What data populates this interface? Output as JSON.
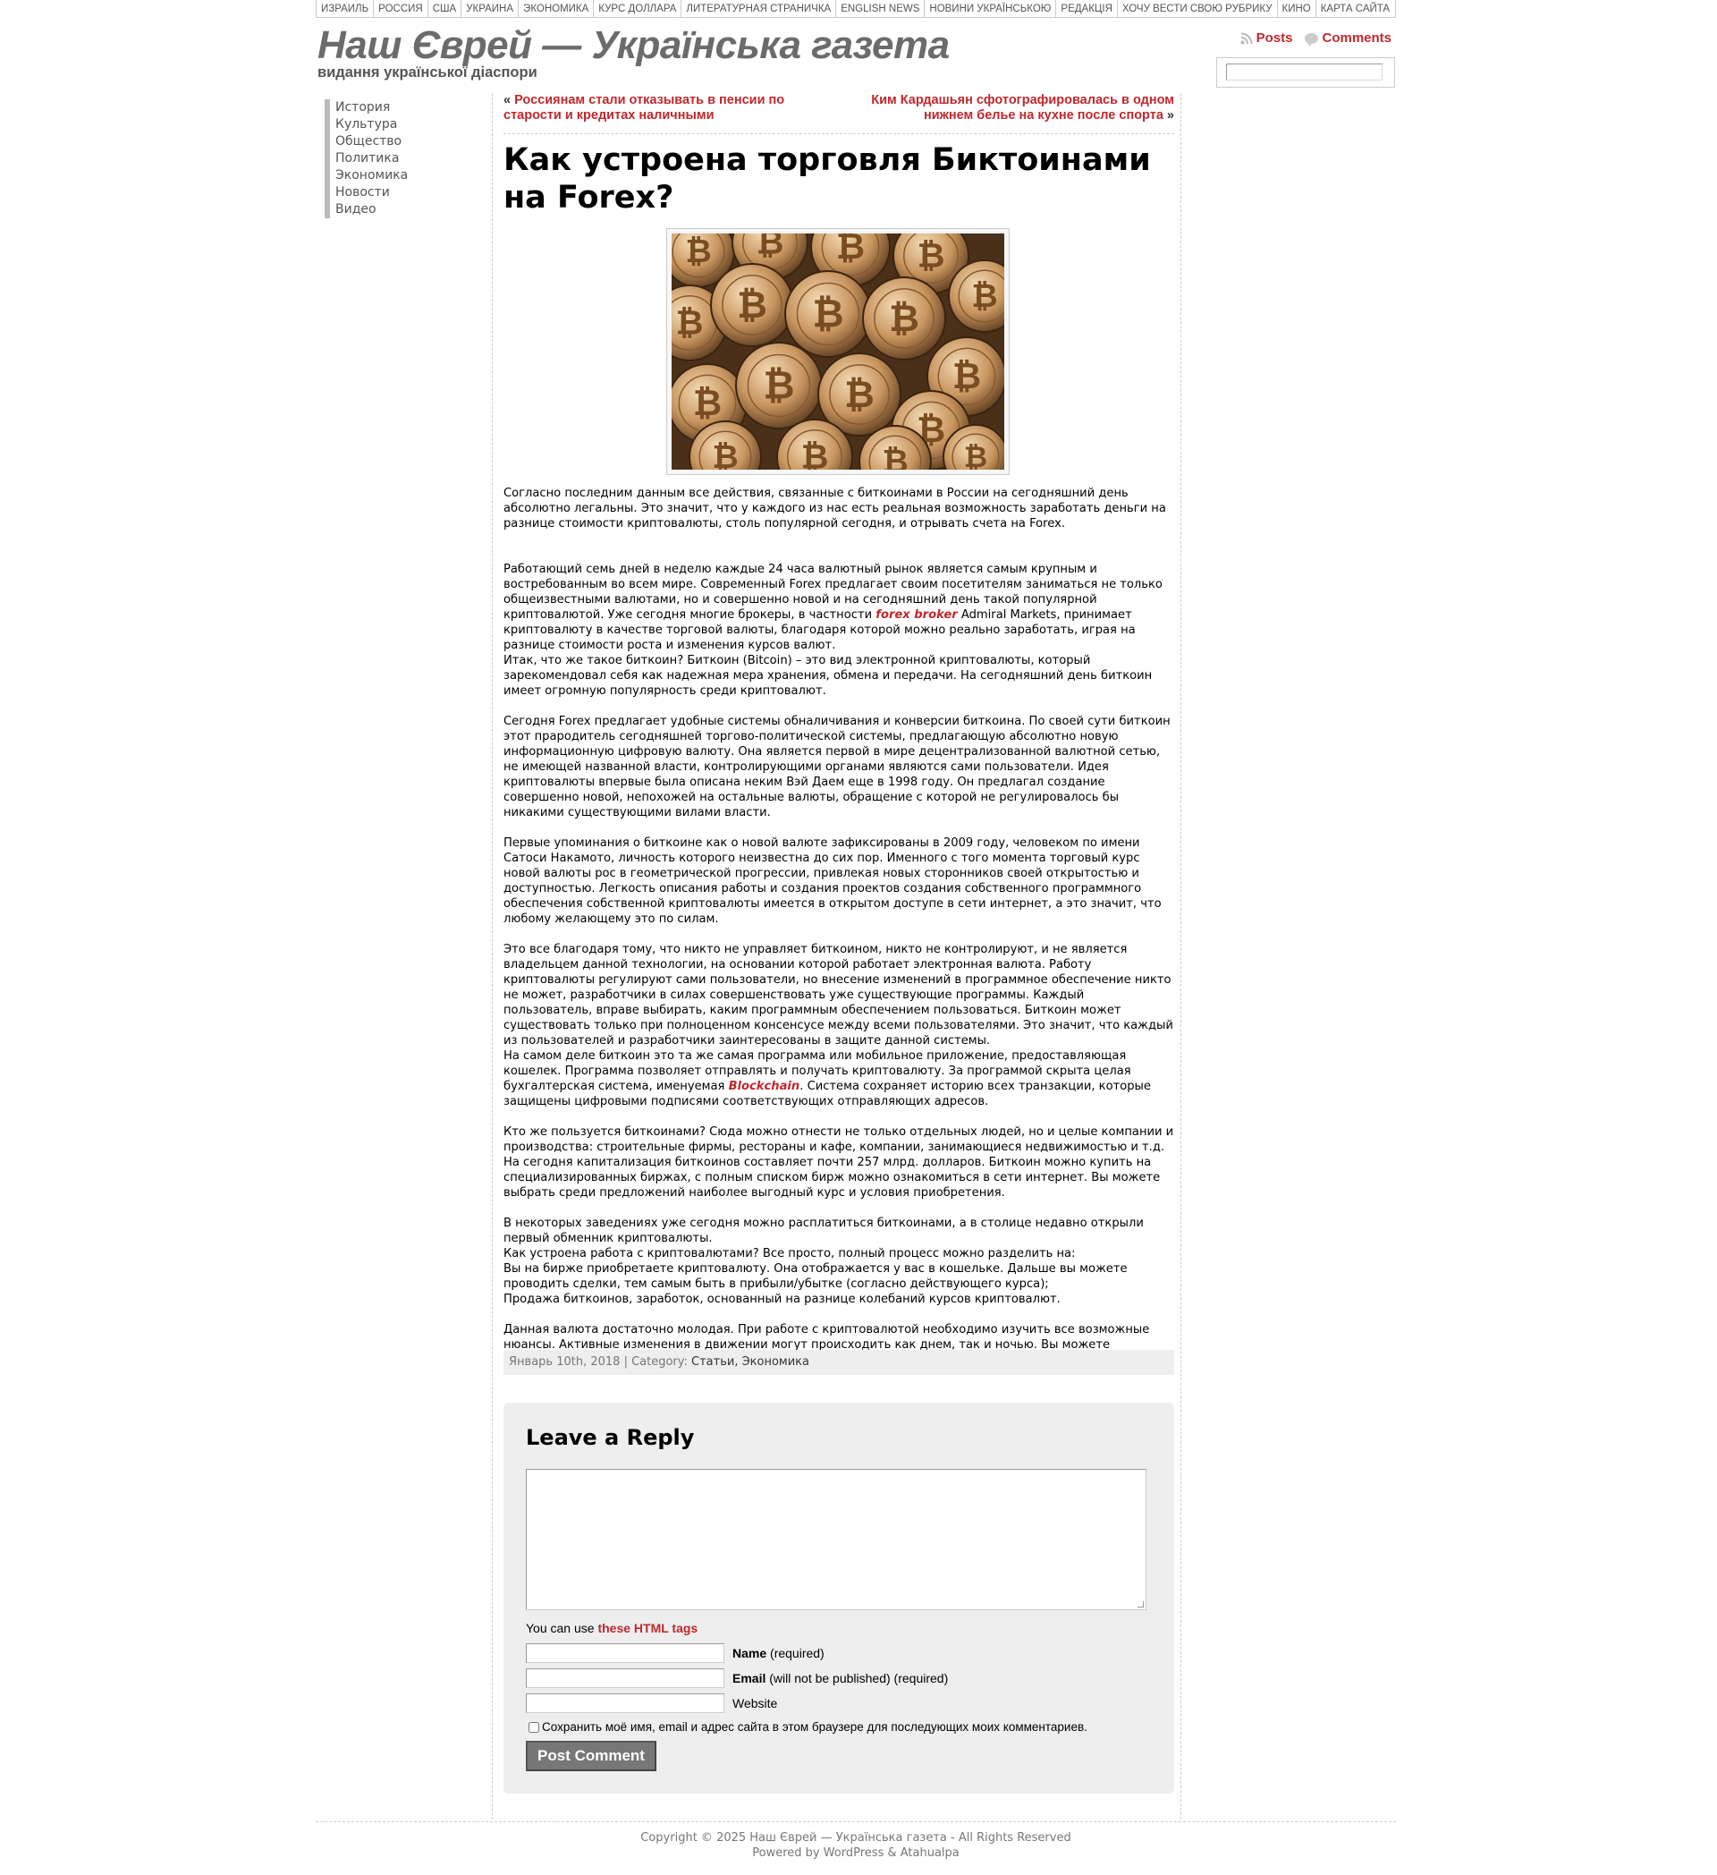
{
  "topnav": [
    "ИЗРАИЛЬ",
    "РОССИЯ",
    "США",
    "УКРАИНА",
    "ЭКОНОМИКА",
    "КУРС ДОЛЛАРА",
    "ЛИТЕРАТУРНАЯ СТРАНИЧКА",
    "ENGLISH NEWS",
    "НОВИНИ УКРАЇНСЬКОЮ",
    "РЕДАКЦІЯ",
    "ХОЧУ ВЕСТИ СВОЮ РУБРИКУ",
    "КИНО",
    "КАРТА САЙТА"
  ],
  "header": {
    "title": "Наш Єврей — Українська газета",
    "description": "видання української діаспори",
    "posts_label": "Posts",
    "comments_label": "Comments",
    "search_placeholder": ""
  },
  "sidebar": [
    "История",
    "Культура",
    "Общество",
    "Политика",
    "Экономика",
    "Новости",
    "Видео"
  ],
  "postnav": {
    "prev_arrow": "«",
    "prev": "Россиянам стали отказывать в пенсии по старости и кредитах наличными",
    "next": "Ким Кардашьян сфотографировалась в одном нижнем белье на кухне после спорта",
    "next_arrow": "»"
  },
  "post": {
    "title": "Как устроена торговля Биктоинами на Forex?",
    "image_alt": "bitcoin coins photo",
    "p1": "Согласно последним данным все действия, связанные с биткоинами в России на сегодняшний день абсолютно легальны. Это значит, что у каждого из нас есть реальная возможность заработать деньги на разнице стоимости криптовалюты, столь популярной сегодня, и отрывать счета на Forex.",
    "p2_before": "Работающий семь дней в неделю каждые 24 часа валютный рынок является самым крупным и востребованным во всем мире. Современный Forex предлагает своим посетителям заниматься не только общеизвестными валютами, но и совершенно новой и на сегодняшний день такой популярной криптовалютой. Уже сегодня многие брокеры, в частности ",
    "p2_link": "forex broker",
    "p2_after": " Admiral Markets, принимает криптовалюту в качестве торговой валюты, благодаря которой можно реально заработать, играя на разнице стоимости роста и изменения курсов валют.",
    "p2_line2": "Итак, что же такое биткоин? Биткоин (Bitcoin) – это вид электронной криптовалюты, который зарекомендовал себя как надежная мера хранения, обмена и передачи. На сегодняшний день биткоин имеет огромную популярность среди криптовалют.",
    "p3": "Сегодня Forex предлагает удобные системы обналичивания и конверсии биткоина. По своей сути биткоин этот прародитель сегодняшней торгово-политической системы, предлагающую абсолютно новую информационную цифровую валюту. Она является первой в мире децентрализованной валютной сетью, не имеющей названной власти, контролирующими органами являются сами пользователи. Идея криптовалюты впервые была описана неким Вэй Даем еще в 1998 году. Он предлагал создание совершенно новой, непохожей на остальные валюты, обращение с которой не регулировалось бы никакими существующими вилами власти.",
    "p4": "Первые упоминания о биткоине как о новой валюте зафиксированы в 2009 году, человеком по имени Сатоси Накамото, личность которого неизвестна до сих пор. Именного с того момента торговый курс новой валюты рос в геометрической прогрессии, привлекая новых сторонников своей открытостью и доступностью. Легкость описания работы и создания проектов создания собственного программного обеспечения собственной криптовалюты имеется в открытом доступе в сети интернет, а это значит, что любому желающему это по силам.",
    "p5": "Это все благодаря тому, что никто не управляет биткоином, никто не контролируют, и не является владельцем данной технологии, на основании которой работает электронная валюта. Работу криптовалюты регулируют сами пользователи, но внесение изменений в программное обеспечение никто не может, разработчики в силах совершенствовать уже существующие программы. Каждый пользователь, вправе выбирать, каким программным обеспечением пользоваться. Биткоин может существовать только при полноценном консенсусе между всеми пользователями. Это значит, что каждый из пользователей и разработчики заинтересованы в защите данной системы.",
    "p5_line2_before": "На самом деле биткоин это та же самая программа или мобильное приложение, предоставляющая кошелек. Программа позволяет отправлять и получать криптовалюту. За программой скрыта целая бухгалтерская система, именуемая ",
    "p5_link": "Blockchain",
    "p5_line2_after": ". Система сохраняет историю всех транзакции, которые защищены цифровыми подписями соответствующих отправляющих адресов.",
    "p6": "Кто же пользуется биткоинами? Сюда можно отнести не только отдельных людей, но и целые компании и производства: строительные фирмы, рестораны и кафе, компании, занимающиеся недвижимостью и т.д. На сегодня капитализация биткоинов составляет почти 257 млрд. долларов. Биткоин можно купить на специализированных биржах, с полным списком бирж можно ознакомиться в сети интернет. Вы можете выбрать среди предложений наиболее выгодный курс и условия приобретения.",
    "p7": "В некоторых заведениях уже сегодня можно расплатиться биткоинами, а в столице недавно открыли первый обменник криптовалюты.",
    "p7_line2": "Как устроена работа с криптовалютами? Все просто, полный процесс можно разделить на:",
    "p7_line3": "Вы на бирже приобретаете криптовалюту. Она отображается у вас в кошельке. Дальше вы можете проводить сделки, тем самым быть в прибыли/убытке (согласно действующего курса);",
    "p7_line4": "Продажа биткоинов, заработок, основанный на разнице колебаний курсов криптовалют.",
    "p8": "Данная валюта достаточно молодая. При работе с криптовалютой необходимо изучить все возможные нюансы. Активные изменения в движении могут происходить как днем, так и ночью. Вы можете разработать собственную стратегию работы с биткоинами.",
    "meta_date": "Январь 10th, 2018 | Category: ",
    "meta_cats": "Статьи, Экономика"
  },
  "reply": {
    "title": "Leave a Reply",
    "tags_prefix": "You can use ",
    "tags_link": "these HTML tags",
    "name_label": "Name",
    "name_note": " (required)",
    "email_label": "Email",
    "email_note": " (will not be published) (required)",
    "website_label": "Website",
    "cookie_text": "Сохранить моё имя, email и адрес сайта в этом браузере для последующих моих комментариев.",
    "submit": "Post Comment"
  },
  "footer": {
    "line1": "Copyright © 2025 Наш Єврей — Українська газета - All Rights Reserved",
    "line2": "Powered by WordPress & Atahualpa"
  },
  "colors": {
    "accent": "#c0282d",
    "title_gray": "#6b6b6b",
    "panel": "#eeeeee"
  }
}
